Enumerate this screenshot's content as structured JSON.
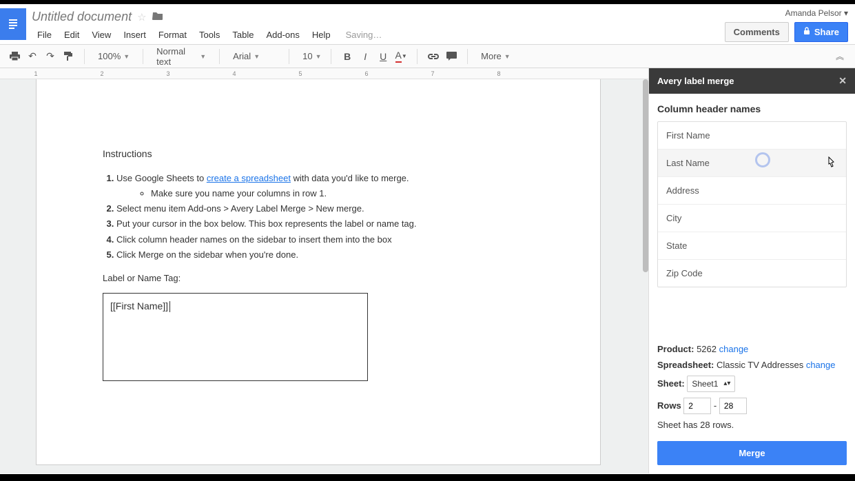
{
  "header": {
    "doc_title": "Untitled document",
    "account_name": "Amanda Pelsor",
    "comments_label": "Comments",
    "share_label": "Share"
  },
  "menubar": {
    "items": [
      "File",
      "Edit",
      "View",
      "Insert",
      "Format",
      "Tools",
      "Table",
      "Add-ons",
      "Help"
    ],
    "status": "Saving…"
  },
  "toolbar": {
    "zoom": "100%",
    "style": "Normal text",
    "font": "Arial",
    "size": "10",
    "more": "More"
  },
  "ruler": {
    "marks": [
      1,
      2,
      3,
      4,
      5,
      6,
      7,
      8
    ]
  },
  "document": {
    "instructions_heading": "Instructions",
    "steps": [
      {
        "pre": "Use Google Sheets to ",
        "link": "create a spreadsheet",
        "post": " with data you'd like to merge."
      },
      {
        "text": "Select menu item Add-ons > Avery Label Merge > New merge."
      },
      {
        "text": "Put your cursor in the box below. This box represents the label or name tag."
      },
      {
        "text": "Click column header names on the sidebar to insert them into the box"
      },
      {
        "text": "Click Merge on the sidebar when you're done."
      }
    ],
    "sub_bullet": "Make sure you name your columns in row 1.",
    "label_prompt": "Label or Name Tag:",
    "label_box_content": "[[First Name]]"
  },
  "sidebar": {
    "title": "Avery label merge",
    "section_title": "Column header names",
    "columns": [
      "First Name",
      "Last Name",
      "Address",
      "City",
      "State",
      "Zip Code"
    ],
    "product_label": "Product:",
    "product_value": "5262",
    "change_label": "change",
    "spreadsheet_label": "Spreadsheet:",
    "spreadsheet_value": "Classic TV Addresses",
    "sheet_label": "Sheet:",
    "sheet_value": "Sheet1",
    "rows_label": "Rows",
    "rows_from": "2",
    "rows_to": "28",
    "rows_dash": "-",
    "rows_info": "Sheet has 28 rows.",
    "merge_label": "Merge"
  }
}
